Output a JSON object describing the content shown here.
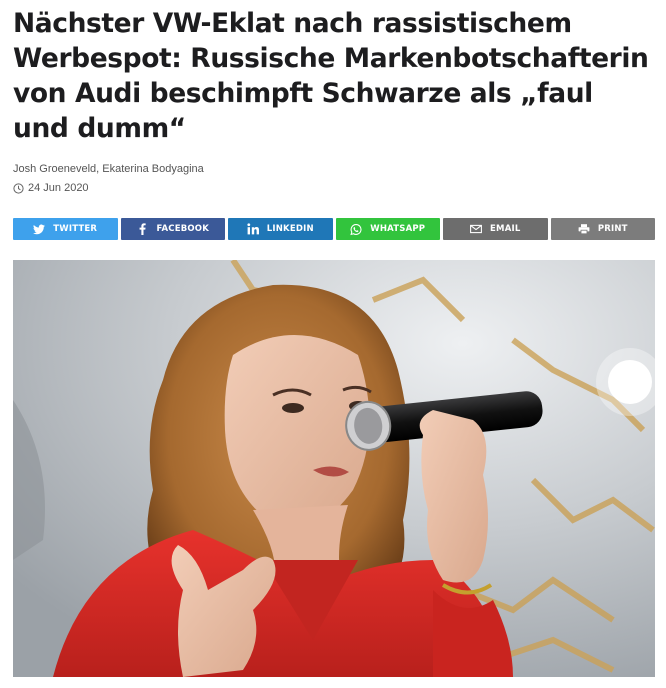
{
  "article": {
    "headline": "Nächster VW-Eklat nach rassistischem Werbespot: Russische Markenbotschafterin von Audi beschimpft Schwarze als „faul und dumm“",
    "authors": "Josh Groeneveld, Ekaterina Bodyagina",
    "date": "24 Jun 2020"
  },
  "share": [
    {
      "label": "TWITTER",
      "icon": "twitter-icon",
      "color": "#3ea1ec"
    },
    {
      "label": "FACEBOOK",
      "icon": "facebook-icon",
      "color": "#3b5998"
    },
    {
      "label": "LINKEDIN",
      "icon": "linkedin-icon",
      "color": "#1f77b7"
    },
    {
      "label": "WHATSAPP",
      "icon": "whatsapp-icon",
      "color": "#32c43d"
    },
    {
      "label": "EMAIL",
      "icon": "email-icon",
      "color": "#6d6d6d"
    },
    {
      "label": "PRINT",
      "icon": "print-icon",
      "color": "#7c7c7c"
    }
  ],
  "colors": {
    "headline": "#1d1d1f",
    "meta": "#555555"
  }
}
